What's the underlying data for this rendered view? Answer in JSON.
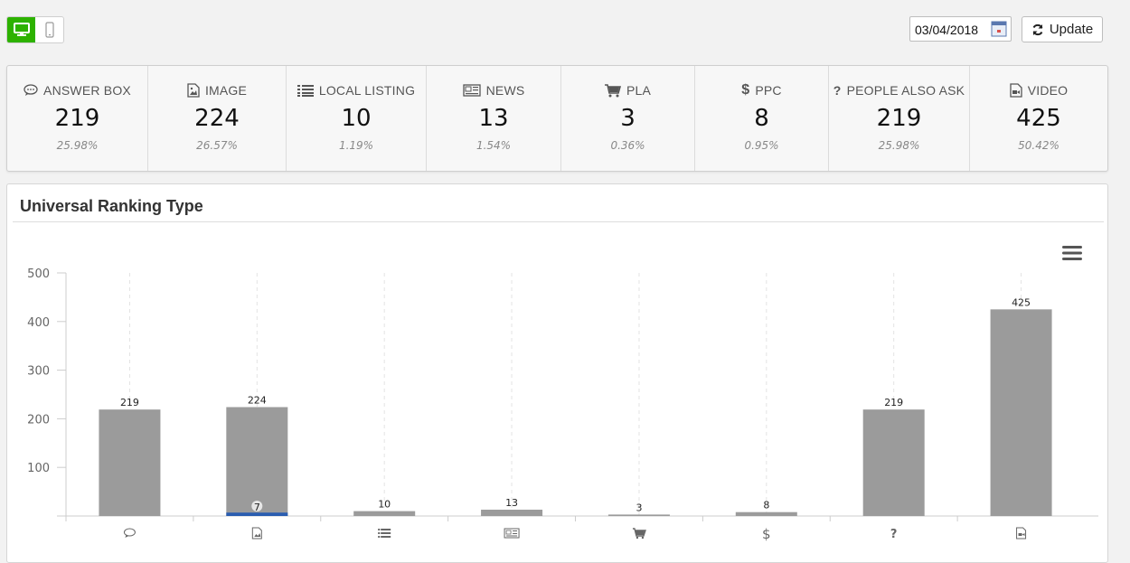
{
  "toolbar": {
    "date_value": "03/04/2018",
    "update_label": "Update",
    "device_icons": [
      "desktop-icon",
      "mobile-icon"
    ]
  },
  "stats": [
    {
      "label": "ANSWER BOX",
      "value": "219",
      "pct": "25.98%",
      "icon": "speech-bubble-icon"
    },
    {
      "label": "IMAGE",
      "value": "224",
      "pct": "26.57%",
      "icon": "image-icon"
    },
    {
      "label": "LOCAL LISTING",
      "value": "10",
      "pct": "1.19%",
      "icon": "list-icon"
    },
    {
      "label": "NEWS",
      "value": "13",
      "pct": "1.54%",
      "icon": "newspaper-icon"
    },
    {
      "label": "PLA",
      "value": "3",
      "pct": "0.36%",
      "icon": "cart-icon"
    },
    {
      "label": "PPC",
      "value": "8",
      "pct": "0.95%",
      "icon": "dollar-icon"
    },
    {
      "label": "PEOPLE ALSO ASK",
      "value": "219",
      "pct": "25.98%",
      "icon": "question-icon"
    },
    {
      "label": "VIDEO",
      "value": "425",
      "pct": "50.42%",
      "icon": "video-file-icon"
    }
  ],
  "chart_panel": {
    "title": "Universal Ranking Type"
  },
  "chart_data": {
    "type": "bar",
    "categories": [
      "ANSWER BOX",
      "IMAGE",
      "LOCAL LISTING",
      "NEWS",
      "PLA",
      "PPC",
      "PEOPLE ALSO ASK",
      "VIDEO"
    ],
    "category_icons": [
      "speech-bubble-icon",
      "image-icon",
      "list-icon",
      "newspaper-icon",
      "cart-icon",
      "dollar-icon",
      "question-icon",
      "video-file-icon"
    ],
    "values": [
      219,
      224,
      10,
      13,
      3,
      8,
      219,
      425
    ],
    "value_labels": [
      "219",
      "224",
      "10",
      "13",
      "3",
      "8",
      "219",
      "425"
    ],
    "yticks": [
      "100",
      "200",
      "300",
      "400",
      "500"
    ],
    "ylim": [
      0,
      500
    ],
    "grid": "vertical-dashed",
    "bar_color": "#9b9b9b",
    "highlight": {
      "category": "IMAGE",
      "value": 7,
      "value_label": "7",
      "color": "#2a5db0"
    }
  },
  "colors": {
    "accent_green": "#2db200",
    "bar_gray": "#9b9b9b",
    "highlight_blue": "#2a5db0"
  }
}
